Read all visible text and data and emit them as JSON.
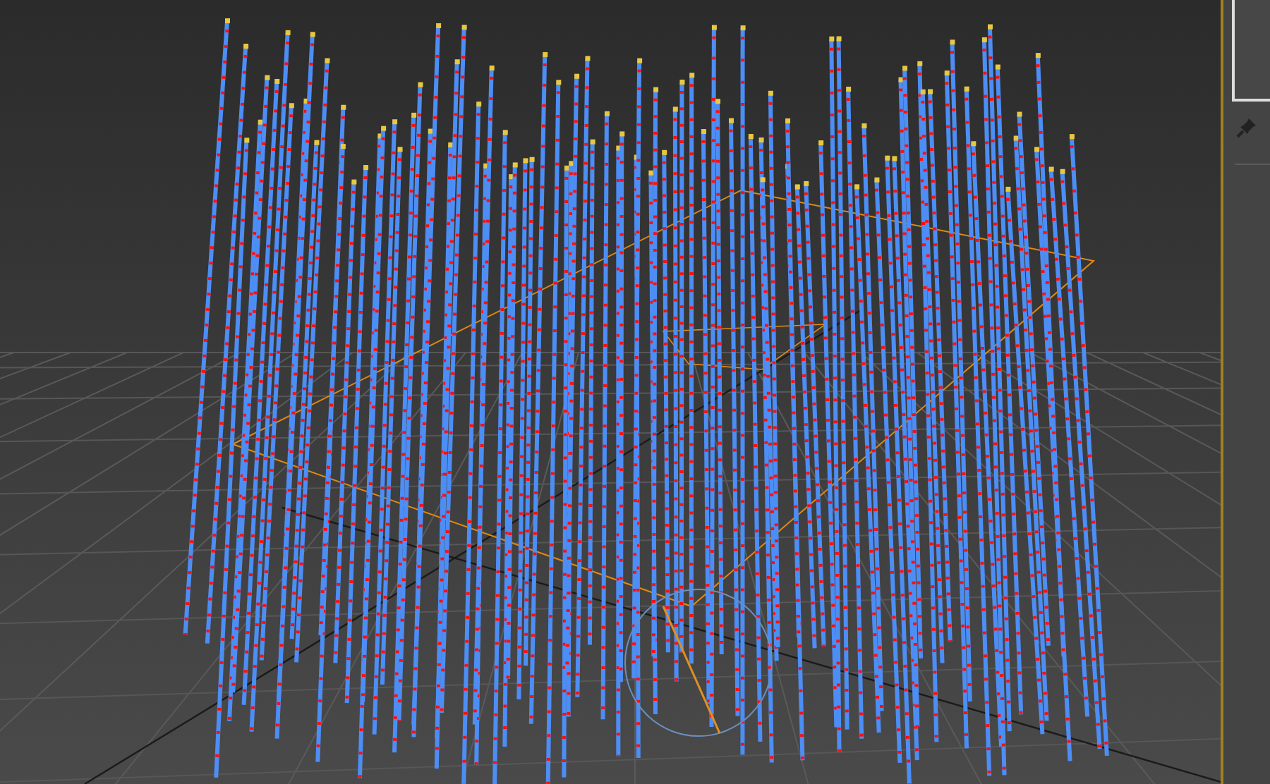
{
  "viewport": {
    "active": true
  },
  "command_panel": {
    "pinned": false
  }
}
